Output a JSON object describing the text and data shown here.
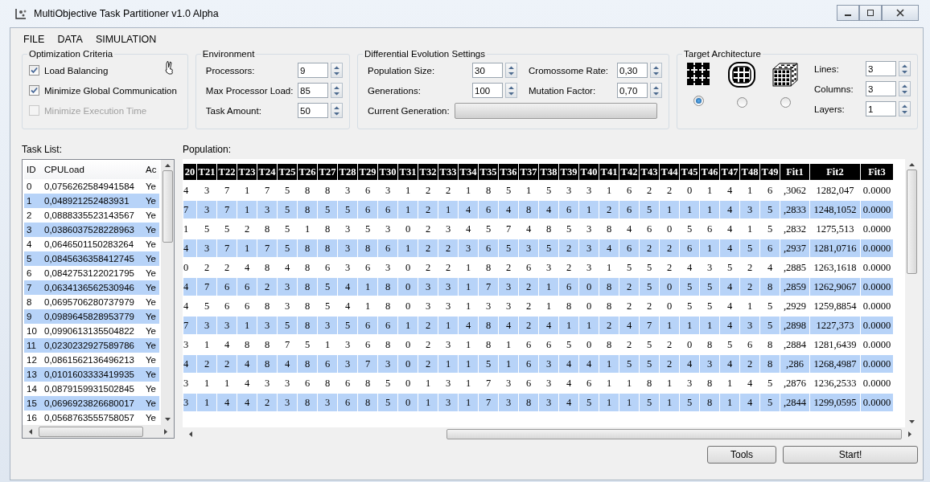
{
  "window": {
    "title": "MultiObjective Task Partitioner v1.0 Alpha"
  },
  "menu": [
    "FILE",
    "DATA",
    "SIMULATION"
  ],
  "optimization_criteria": {
    "title": "Optimization Criteria",
    "items": [
      {
        "label": "Load Balancing",
        "checked": true,
        "disabled": false
      },
      {
        "label": "Minimize Global Communication",
        "checked": true,
        "disabled": false
      },
      {
        "label": "Minimize Execution Time",
        "checked": false,
        "disabled": true
      }
    ]
  },
  "environment": {
    "title": "Environment",
    "fields": [
      {
        "label": "Processors:",
        "value": "9"
      },
      {
        "label": "Max Processor Load:",
        "value": "85"
      },
      {
        "label": "Task Amount:",
        "value": "50"
      }
    ]
  },
  "de_settings": {
    "title": "Differential Evolution Settings",
    "fields": [
      {
        "label": "Population Size:",
        "value": "30"
      },
      {
        "label": "Cromossome Rate:",
        "value": "0,30"
      },
      {
        "label": "Generations:",
        "value": "100"
      },
      {
        "label": "Mutation Factor:",
        "value": "0,70"
      }
    ],
    "current_generation": {
      "label": "Current Generation:",
      "level": 0
    }
  },
  "target_architecture": {
    "title": "Target Architecture",
    "topologies": [
      {
        "kind": "mesh",
        "selected": true
      },
      {
        "kind": "torus",
        "selected": false
      },
      {
        "kind": "cube",
        "selected": false
      }
    ],
    "fields": [
      {
        "label": "Lines:",
        "value": "3"
      },
      {
        "label": "Columns:",
        "value": "3"
      },
      {
        "label": "Layers:",
        "value": "1"
      }
    ]
  },
  "task_list": {
    "title": "Task List:",
    "columns": [
      "ID",
      "CPULoad",
      "Ac"
    ],
    "rows": [
      [
        "0",
        "0,0756262584941584",
        "Ye"
      ],
      [
        "1",
        "0,048921252483931",
        "Ye"
      ],
      [
        "2",
        "0,0888335523143567",
        "Ye"
      ],
      [
        "3",
        "0,0386037528228963",
        "Ye"
      ],
      [
        "4",
        "0,0646501150283264",
        "Ye"
      ],
      [
        "5",
        "0,0845636358412745",
        "Ye"
      ],
      [
        "6",
        "0,0842753122021795",
        "Ye"
      ],
      [
        "7",
        "0,0634136562530946",
        "Ye"
      ],
      [
        "8",
        "0,0695706280737979",
        "Ye"
      ],
      [
        "9",
        "0,0989645828953779",
        "Ye"
      ],
      [
        "10",
        "0,0990613135504822",
        "Ye"
      ],
      [
        "11",
        "0,0230232927589786",
        "Ye"
      ],
      [
        "12",
        "0,0861562136496213",
        "Ye"
      ],
      [
        "13",
        "0,0101603333419935",
        "Ye"
      ],
      [
        "14",
        "0,0879159931502845",
        "Ye"
      ],
      [
        "15",
        "0,0696923826680017",
        "Ye"
      ],
      [
        "16",
        "0,0568763555758057",
        "Ye"
      ]
    ]
  },
  "population": {
    "title": "Population:",
    "columns": [
      "20",
      "T21",
      "T22",
      "T23",
      "T24",
      "T25",
      "T26",
      "T27",
      "T28",
      "T29",
      "T30",
      "T31",
      "T32",
      "T33",
      "T34",
      "T35",
      "T36",
      "T37",
      "T38",
      "T39",
      "T40",
      "T41",
      "T42",
      "T43",
      "T44",
      "T45",
      "T46",
      "T47",
      "T48",
      "T49",
      "Fit1",
      "Fit2",
      "Fit3"
    ],
    "rows": [
      [
        "4",
        "3",
        "7",
        "1",
        "7",
        "5",
        "8",
        "8",
        "3",
        "6",
        "3",
        "1",
        "2",
        "2",
        "1",
        "8",
        "5",
        "1",
        "5",
        "3",
        "3",
        "1",
        "6",
        "2",
        "2",
        "0",
        "1",
        "4",
        "1",
        "6",
        ",3062",
        "1282,047",
        "0.0000"
      ],
      [
        "7",
        "3",
        "7",
        "1",
        "3",
        "5",
        "8",
        "5",
        "5",
        "6",
        "6",
        "1",
        "2",
        "1",
        "4",
        "6",
        "4",
        "8",
        "4",
        "6",
        "1",
        "2",
        "6",
        "5",
        "1",
        "1",
        "1",
        "4",
        "3",
        "5",
        ",2833",
        "1248,1052",
        "0.0000"
      ],
      [
        "1",
        "5",
        "5",
        "2",
        "8",
        "5",
        "1",
        "8",
        "3",
        "5",
        "3",
        "0",
        "2",
        "3",
        "4",
        "5",
        "7",
        "4",
        "8",
        "5",
        "3",
        "8",
        "4",
        "6",
        "0",
        "5",
        "6",
        "4",
        "1",
        "5",
        ",2832",
        "1275,513",
        "0.0000"
      ],
      [
        "4",
        "3",
        "7",
        "1",
        "7",
        "5",
        "8",
        "8",
        "3",
        "8",
        "6",
        "1",
        "2",
        "2",
        "3",
        "6",
        "5",
        "3",
        "5",
        "2",
        "3",
        "4",
        "6",
        "2",
        "2",
        "6",
        "1",
        "4",
        "5",
        "6",
        ",2937",
        "1281,0716",
        "0.0000"
      ],
      [
        "0",
        "2",
        "2",
        "4",
        "8",
        "4",
        "8",
        "6",
        "3",
        "6",
        "3",
        "0",
        "2",
        "2",
        "1",
        "8",
        "2",
        "6",
        "3",
        "2",
        "3",
        "1",
        "5",
        "5",
        "2",
        "4",
        "3",
        "5",
        "2",
        "4",
        ",2885",
        "1263,1618",
        "0.0000"
      ],
      [
        "4",
        "7",
        "6",
        "6",
        "2",
        "3",
        "8",
        "5",
        "4",
        "1",
        "8",
        "0",
        "3",
        "3",
        "1",
        "7",
        "3",
        "2",
        "1",
        "6",
        "0",
        "8",
        "2",
        "5",
        "0",
        "5",
        "5",
        "4",
        "2",
        "8",
        ",2859",
        "1262,9067",
        "0.0000"
      ],
      [
        "4",
        "5",
        "6",
        "6",
        "8",
        "3",
        "8",
        "5",
        "4",
        "1",
        "8",
        "0",
        "3",
        "3",
        "1",
        "3",
        "3",
        "2",
        "1",
        "8",
        "0",
        "8",
        "2",
        "2",
        "0",
        "5",
        "5",
        "4",
        "1",
        "5",
        ",2929",
        "1259,8854",
        "0.0000"
      ],
      [
        "7",
        "3",
        "3",
        "1",
        "3",
        "5",
        "8",
        "3",
        "5",
        "6",
        "6",
        "1",
        "2",
        "1",
        "4",
        "8",
        "4",
        "2",
        "4",
        "1",
        "1",
        "2",
        "4",
        "7",
        "1",
        "1",
        "1",
        "4",
        "3",
        "5",
        ",2898",
        "1227,373",
        "0.0000"
      ],
      [
        "3",
        "1",
        "4",
        "8",
        "8",
        "7",
        "5",
        "1",
        "3",
        "6",
        "8",
        "0",
        "2",
        "3",
        "1",
        "8",
        "1",
        "6",
        "6",
        "5",
        "0",
        "8",
        "2",
        "5",
        "2",
        "0",
        "8",
        "5",
        "6",
        "8",
        ",2884",
        "1281,6439",
        "0.0000"
      ],
      [
        "4",
        "2",
        "2",
        "4",
        "8",
        "4",
        "8",
        "6",
        "3",
        "7",
        "3",
        "0",
        "2",
        "1",
        "1",
        "5",
        "1",
        "6",
        "3",
        "4",
        "4",
        "1",
        "5",
        "5",
        "2",
        "4",
        "3",
        "4",
        "2",
        "8",
        ",286",
        "1268,4987",
        "0.0000"
      ],
      [
        "3",
        "1",
        "1",
        "4",
        "3",
        "3",
        "6",
        "8",
        "6",
        "8",
        "5",
        "0",
        "1",
        "3",
        "1",
        "7",
        "3",
        "6",
        "3",
        "4",
        "6",
        "1",
        "1",
        "8",
        "1",
        "3",
        "8",
        "1",
        "4",
        "5",
        ",2876",
        "1236,2533",
        "0.0000"
      ],
      [
        "3",
        "1",
        "4",
        "4",
        "2",
        "3",
        "8",
        "3",
        "6",
        "8",
        "5",
        "0",
        "1",
        "3",
        "1",
        "7",
        "3",
        "8",
        "3",
        "4",
        "5",
        "1",
        "1",
        "5",
        "1",
        "5",
        "8",
        "1",
        "4",
        "5",
        ",2844",
        "1299,0595",
        "0.0000"
      ]
    ]
  },
  "buttons": [
    "Tools",
    "Start!"
  ]
}
